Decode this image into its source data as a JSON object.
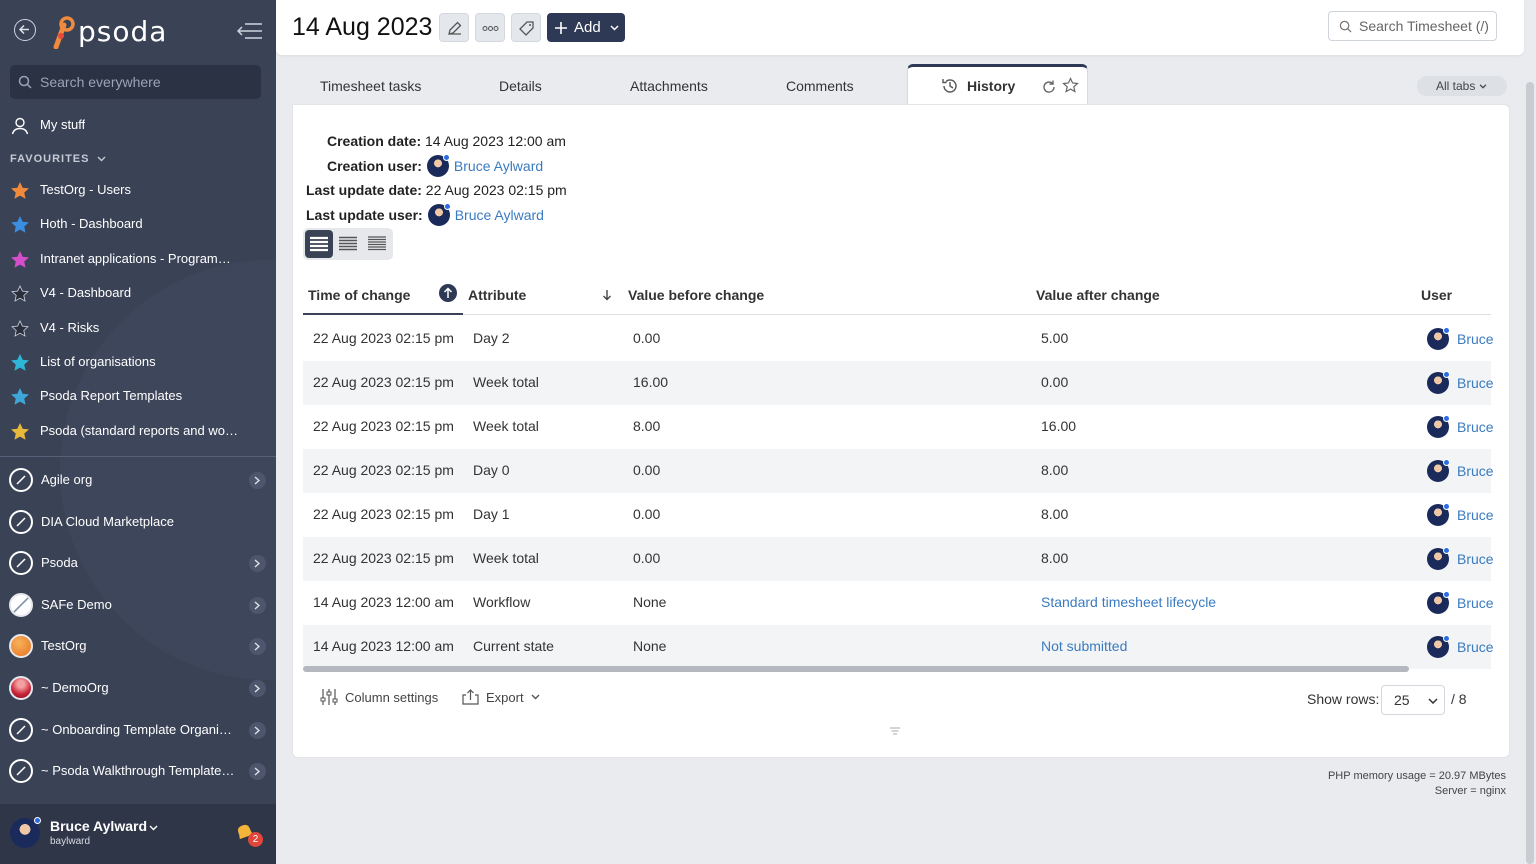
{
  "sidebar": {
    "logo": "psoda",
    "search_placeholder": "Search everywhere",
    "my_stuff": "My stuff",
    "favourites_heading": "FAVOURITES",
    "favourites": [
      {
        "label": "TestOrg - Users",
        "color": "#f08a3c"
      },
      {
        "label": "Hoth - Dashboard",
        "color": "#3b8de0"
      },
      {
        "label": "Intranet applications - Programme...",
        "color": "#d44fc9"
      },
      {
        "label": "V4 - Dashboard",
        "color": "#2a2f3c"
      },
      {
        "label": "V4 - Risks",
        "color": "#2a2f3c"
      },
      {
        "label": "List of organisations",
        "color": "#2fb6d6"
      },
      {
        "label": "Psoda Report Templates",
        "color": "#3fa7d8"
      },
      {
        "label": "Psoda (standard reports and work...",
        "color": "#e8b93a"
      }
    ],
    "organisations": [
      {
        "label": "Agile org",
        "icon": "compass-icon",
        "has_arrow": true
      },
      {
        "label": "DIA Cloud Marketplace",
        "icon": "compass-icon",
        "has_arrow": false
      },
      {
        "label": "Psoda",
        "icon": "compass-icon",
        "has_arrow": true
      },
      {
        "label": "SAFe Demo",
        "icon": "mountain-icon",
        "has_arrow": true
      },
      {
        "label": "TestOrg",
        "icon": "orange-circle-icon",
        "has_arrow": true
      },
      {
        "label": "~ DemoOrg",
        "icon": "red-planet-icon",
        "has_arrow": true
      },
      {
        "label": "~ Onboarding Template Organisa...",
        "icon": "compass-icon",
        "has_arrow": true
      },
      {
        "label": "~ Psoda Walkthrough Template P...",
        "icon": "compass-icon",
        "has_arrow": true
      }
    ],
    "user": {
      "name": "Bruce Aylward",
      "username": "baylward",
      "notifications": "2"
    }
  },
  "header": {
    "title": "14 Aug 2023",
    "add_label": "Add",
    "search_placeholder": "Search Timesheet (/)"
  },
  "tabs": [
    {
      "label": "Timesheet tasks"
    },
    {
      "label": "Details"
    },
    {
      "label": "Attachments"
    },
    {
      "label": "Comments"
    },
    {
      "label": "History",
      "active": true
    }
  ],
  "all_tabs_label": "All tabs",
  "meta": {
    "creation_date_label": "Creation date:",
    "creation_date": "14 Aug 2023 12:00 am",
    "creation_user_label": "Creation user:",
    "creation_user": "Bruce Aylward",
    "last_update_date_label": "Last update date:",
    "last_update_date": "22 Aug 2023 02:15 pm",
    "last_update_user_label": "Last update user:",
    "last_update_user": "Bruce Aylward"
  },
  "table": {
    "columns": [
      "Time of change",
      "Attribute",
      "Value before change",
      "Value after change",
      "User"
    ],
    "rows": [
      {
        "time": "22 Aug 2023 02:15 pm",
        "attribute": "Day 2",
        "before": "0.00",
        "after": "5.00",
        "after_link": false,
        "user": "Bruce"
      },
      {
        "time": "22 Aug 2023 02:15 pm",
        "attribute": "Week total",
        "before": "16.00",
        "after": "0.00",
        "after_link": false,
        "user": "Bruce"
      },
      {
        "time": "22 Aug 2023 02:15 pm",
        "attribute": "Week total",
        "before": "8.00",
        "after": "16.00",
        "after_link": false,
        "user": "Bruce"
      },
      {
        "time": "22 Aug 2023 02:15 pm",
        "attribute": "Day 0",
        "before": "0.00",
        "after": "8.00",
        "after_link": false,
        "user": "Bruce"
      },
      {
        "time": "22 Aug 2023 02:15 pm",
        "attribute": "Day 1",
        "before": "0.00",
        "after": "8.00",
        "after_link": false,
        "user": "Bruce"
      },
      {
        "time": "22 Aug 2023 02:15 pm",
        "attribute": "Week total",
        "before": "0.00",
        "after": "8.00",
        "after_link": false,
        "user": "Bruce"
      },
      {
        "time": "14 Aug 2023 12:00 am",
        "attribute": "Workflow",
        "before": "None",
        "after": "Standard timesheet lifecycle",
        "after_link": true,
        "user": "Bruce"
      },
      {
        "time": "14 Aug 2023 12:00 am",
        "attribute": "Current state",
        "before": "None",
        "after": "Not submitted",
        "after_link": true,
        "user": "Bruce"
      }
    ]
  },
  "footer": {
    "column_settings": "Column settings",
    "export": "Export",
    "show_rows_label": "Show rows:",
    "show_rows_value": "25",
    "pages": "/ 8"
  },
  "server_info": {
    "memory": "PHP memory usage = 20.97 MBytes",
    "server": "Server = nginx"
  },
  "colors": {
    "sidebar_bg": "#3a4256",
    "accent_dark": "#2e3a55",
    "link": "#3a7bc0"
  }
}
